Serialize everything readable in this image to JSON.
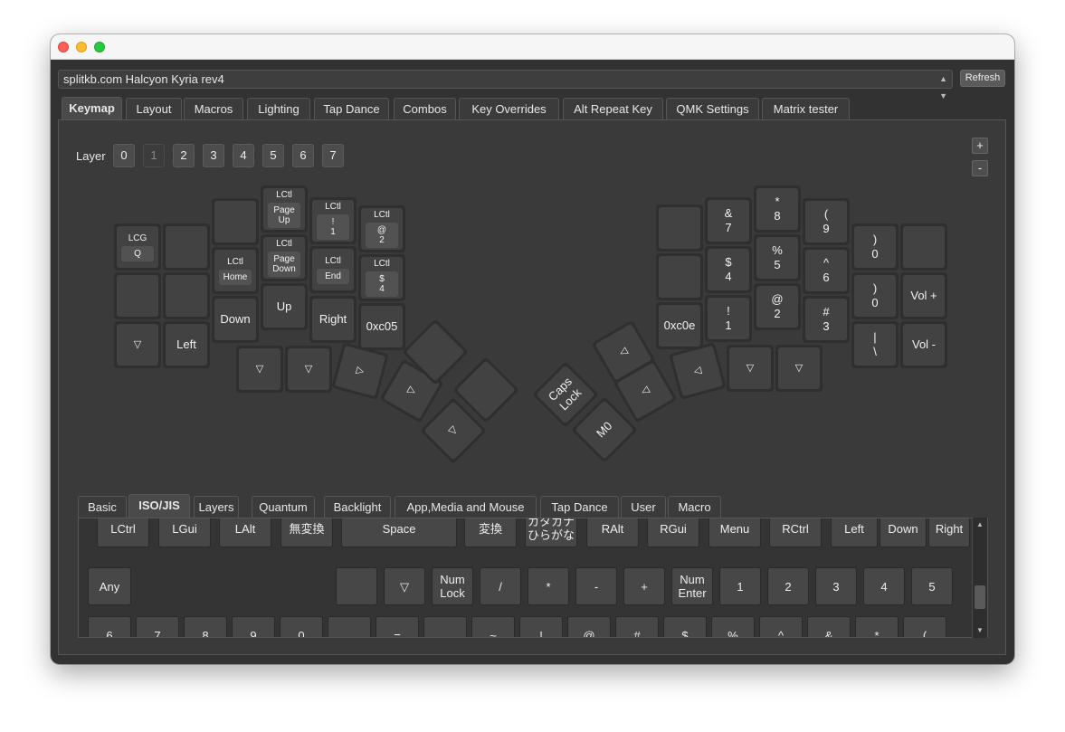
{
  "window": {
    "title": ""
  },
  "device": {
    "selected": "splitkb.com Halcyon Kyria rev4",
    "refresh_label": "Refresh"
  },
  "main_tabs": [
    "Keymap",
    "Layout",
    "Macros",
    "Lighting",
    "Tap Dance",
    "Combos",
    "Key Overrides",
    "Alt Repeat Key",
    "QMK Settings",
    "Matrix tester"
  ],
  "layer": {
    "label": "Layer",
    "layers": [
      "0",
      "1",
      "2",
      "3",
      "4",
      "5",
      "6",
      "7"
    ],
    "selected": "1",
    "add_label": "+",
    "remove_label": "-"
  },
  "left_keys": [
    {
      "mod": "LCG",
      "inner": "Q"
    },
    {
      "label": ""
    },
    {
      "label": ""
    },
    {
      "mod": "LCtl",
      "inner": "Page\nUp"
    },
    {
      "mod": "LCtl",
      "inner": "!\n1"
    },
    {
      "mod": "LCtl",
      "inner": "@\n2"
    },
    {
      "label": ""
    },
    {
      "label": ""
    },
    {
      "mod": "LCtl",
      "inner": "Home"
    },
    {
      "mod": "LCtl",
      "inner": "Page\nDown"
    },
    {
      "mod": "LCtl",
      "inner": "End"
    },
    {
      "mod": "LCtl",
      "inner": "$\n4"
    },
    {
      "label": "▽"
    },
    {
      "label": "Left"
    },
    {
      "label": "Down"
    },
    {
      "label": "Up"
    },
    {
      "label": "Right"
    },
    {
      "label": "0xc05"
    },
    {
      "label": "▽"
    },
    {
      "label": "▽"
    },
    {
      "label": "▷"
    },
    {
      "label": "▷"
    },
    {
      "label": "▷"
    },
    {
      "label": ""
    },
    {
      "label": ""
    }
  ],
  "right_keys": [
    {
      "label": ""
    },
    {
      "label": "&\n7"
    },
    {
      "label": "*\n8"
    },
    {
      "label": "(\n9"
    },
    {
      "label": ")\n0"
    },
    {
      "label": ""
    },
    {
      "label": ""
    },
    {
      "label": "$\n4"
    },
    {
      "label": "%\n5"
    },
    {
      "label": "^\n6"
    },
    {
      "label": ")\n0"
    },
    {
      "label": "Vol +"
    },
    {
      "label": "0xc0e"
    },
    {
      "label": "!\n1"
    },
    {
      "label": "@\n2"
    },
    {
      "label": "#\n3"
    },
    {
      "label": "|\n\\"
    },
    {
      "label": "Vol -"
    },
    {
      "label": "◁"
    },
    {
      "label": "◁"
    },
    {
      "label": "◁"
    },
    {
      "label": "▽"
    },
    {
      "label": "▽"
    },
    {
      "label": "Caps\nLock"
    },
    {
      "label": "M0"
    }
  ],
  "keycode_tabs": [
    "Basic",
    "ISO/JIS",
    "Layers",
    "Quantum",
    "Backlight",
    "App,Media and Mouse",
    "Tap Dance",
    "User",
    "Macro"
  ],
  "keycode_selected_tab": "ISO/JIS",
  "keycodes_row1": [
    "LCtrl",
    "LGui",
    "LAlt",
    "無変換",
    "Space",
    "変換",
    "カタカナ\nひらがな",
    "RAlt",
    "RGui",
    "Menu",
    "RCtrl",
    "Left",
    "Down",
    "Right"
  ],
  "keycodes_row2": [
    "Any",
    "",
    "▽",
    "Num\nLock",
    "/",
    "*",
    "-",
    "+",
    "Num\nEnter",
    "1",
    "2",
    "3",
    "4",
    "5"
  ],
  "keycodes_row3": [
    "6",
    "7",
    "8",
    "9",
    "0",
    "",
    "=",
    "",
    "~",
    "!",
    "@",
    "#",
    "$",
    "%",
    "^",
    "&",
    "*",
    "("
  ]
}
